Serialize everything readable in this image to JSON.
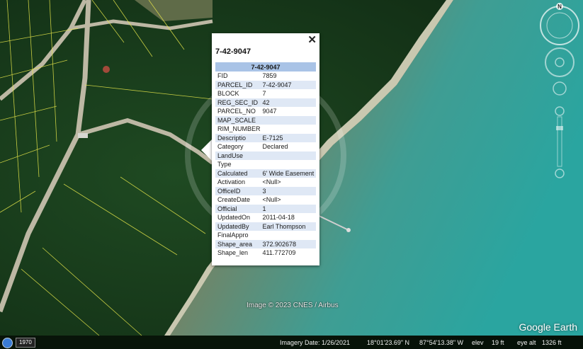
{
  "popup": {
    "title": "7-42-9047",
    "table_header": "7-42-9047",
    "rows": [
      {
        "k": "FID",
        "v": "7859"
      },
      {
        "k": "PARCEL_ID",
        "v": "7-42-9047"
      },
      {
        "k": "BLOCK",
        "v": "7"
      },
      {
        "k": "REG_SEC_ID",
        "v": "42"
      },
      {
        "k": "PARCEL_NO",
        "v": "9047"
      },
      {
        "k": "MAP_SCALE",
        "v": ""
      },
      {
        "k": "RIM_NUMBER",
        "v": ""
      },
      {
        "k": "Descriptio",
        "v": "E-7125"
      },
      {
        "k": "Category",
        "v": "Declared"
      },
      {
        "k": "LandUse",
        "v": ""
      },
      {
        "k": "Type",
        "v": ""
      },
      {
        "k": "Calculated",
        "v": "6' Wide Easement"
      },
      {
        "k": "Activation",
        "v": "<Null>"
      },
      {
        "k": "OfficeID",
        "v": "3"
      },
      {
        "k": "CreateDate",
        "v": "<Null>"
      },
      {
        "k": "Official",
        "v": "1"
      },
      {
        "k": "UpdatedOn",
        "v": "2011-04-18"
      },
      {
        "k": "UpdatedBy",
        "v": "Earl Thompson"
      },
      {
        "k": "FinalAppro",
        "v": ""
      },
      {
        "k": "Shape_area",
        "v": "372.902678"
      },
      {
        "k": "Shape_len",
        "v": "411.772709"
      }
    ]
  },
  "map": {
    "watermark": "Image © 2023 CNES / Airbus",
    "logo": "Google Earth",
    "compass_label": "N"
  },
  "status": {
    "year": "1970",
    "imagery_date": "Imagery Date: 1/26/2021",
    "lat": "18°01'23.69\" N",
    "lon": "87°54'13.38\" W",
    "elev_label": "elev",
    "elev_value": "19 ft",
    "eye_alt_label": "eye alt",
    "eye_alt_value": "1326 ft"
  },
  "colors": {
    "popup_header": "#a9c3e6",
    "popup_row_alt": "#dfe8f5",
    "parcel_lines": "#e6e64a"
  }
}
